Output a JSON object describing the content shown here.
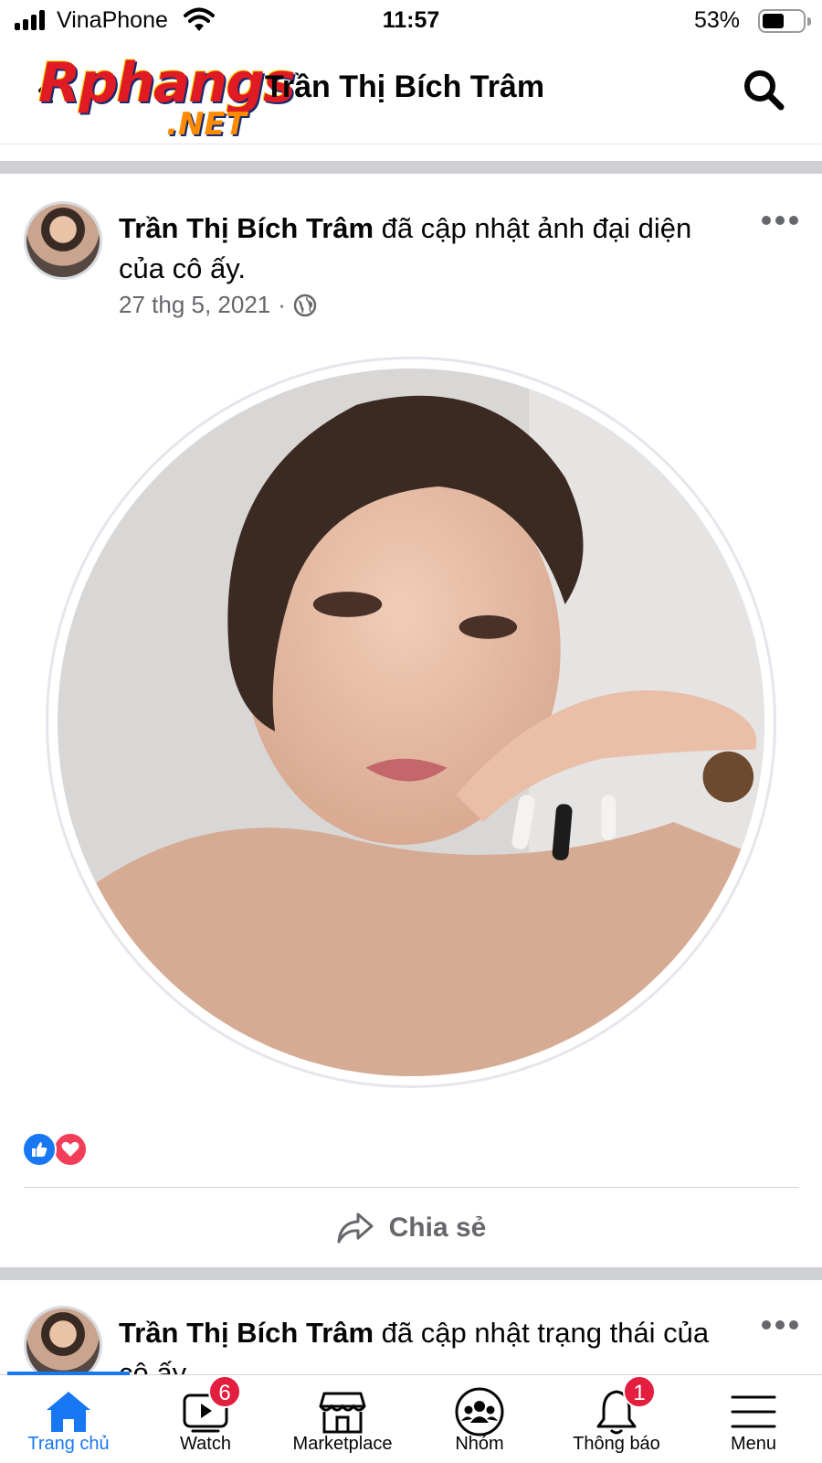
{
  "status_bar": {
    "carrier": "VinaPhone",
    "time": "11:57",
    "battery_percent": "53%",
    "battery_level": 0.53,
    "signal_bars": 4
  },
  "header": {
    "title": "Trần Thị Bích Trâm",
    "back_icon": "chevron-left-icon",
    "search_icon": "search-icon",
    "watermark_main": "Rphangs",
    "watermark_sub": ".NET"
  },
  "posts": [
    {
      "author": "Trần Thị Bích Trâm",
      "action": " đã cập nhật ảnh đại diện của cô ấy.",
      "date": "27 thg 5, 2021",
      "separator": " · ",
      "privacy_icon": "globe-icon",
      "reactions": [
        "like",
        "love"
      ],
      "share_label": "Chia sẻ"
    },
    {
      "author": "Trần Thị Bích Trâm",
      "action": " đã cập nhật trạng thái của cô ấy."
    }
  ],
  "tabs": [
    {
      "label": "Trang chủ",
      "icon": "home-icon",
      "active": true
    },
    {
      "label": "Watch",
      "icon": "video-icon",
      "badge": "6"
    },
    {
      "label": "Marketplace",
      "icon": "shop-icon"
    },
    {
      "label": "Nhóm",
      "icon": "groups-icon"
    },
    {
      "label": "Thông báo",
      "icon": "bell-icon",
      "badge": "1"
    },
    {
      "label": "Menu",
      "icon": "menu-icon"
    }
  ],
  "colors": {
    "accent": "#1877f2",
    "badge": "#e41e3f",
    "love": "#f33e58",
    "secondary_text": "#65676b"
  }
}
